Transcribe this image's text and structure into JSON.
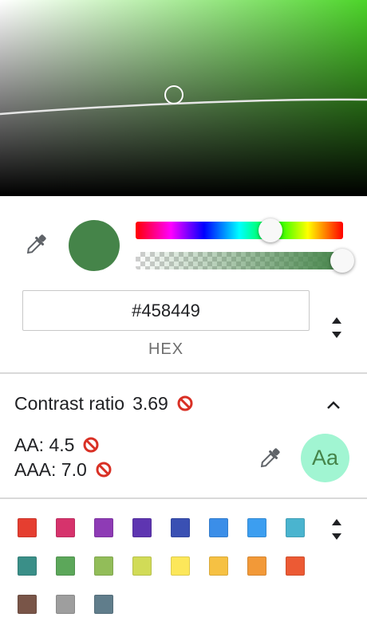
{
  "picker": {
    "hex_value": "#458449",
    "format_label": "HEX",
    "current_color": "#458449",
    "hue_degrees": 124,
    "alpha": 1.0,
    "area_hue_color": "#4cd429"
  },
  "contrast": {
    "label": "Contrast ratio",
    "ratio": "3.69",
    "aa_label": "AA: 4.5",
    "aaa_label": "AAA: 7.0",
    "preview_text": "Aa",
    "preview_bg": "#a1f5d2",
    "fail_color": "#d93025"
  },
  "palette": {
    "rows": [
      [
        "#e53e30",
        "#d6336c",
        "#8e3bb5",
        "#5e35b1",
        "#3a50b3",
        "#3b8ee8",
        "#3c9ef0",
        "#4ab4cf"
      ],
      [
        "#3a8f88",
        "#5ca75a",
        "#92bd59",
        "#d1db57",
        "#fce75a",
        "#f6c143",
        "#f29938",
        "#ec5a34"
      ],
      [
        "#795548",
        "#9e9e9e",
        "#607d8b"
      ]
    ]
  },
  "icons": {
    "eyedropper": "eyedropper-icon",
    "no_entry": "no-entry-icon",
    "collapse": "chevron-up-icon",
    "toggle": "updown-arrows-icon"
  }
}
